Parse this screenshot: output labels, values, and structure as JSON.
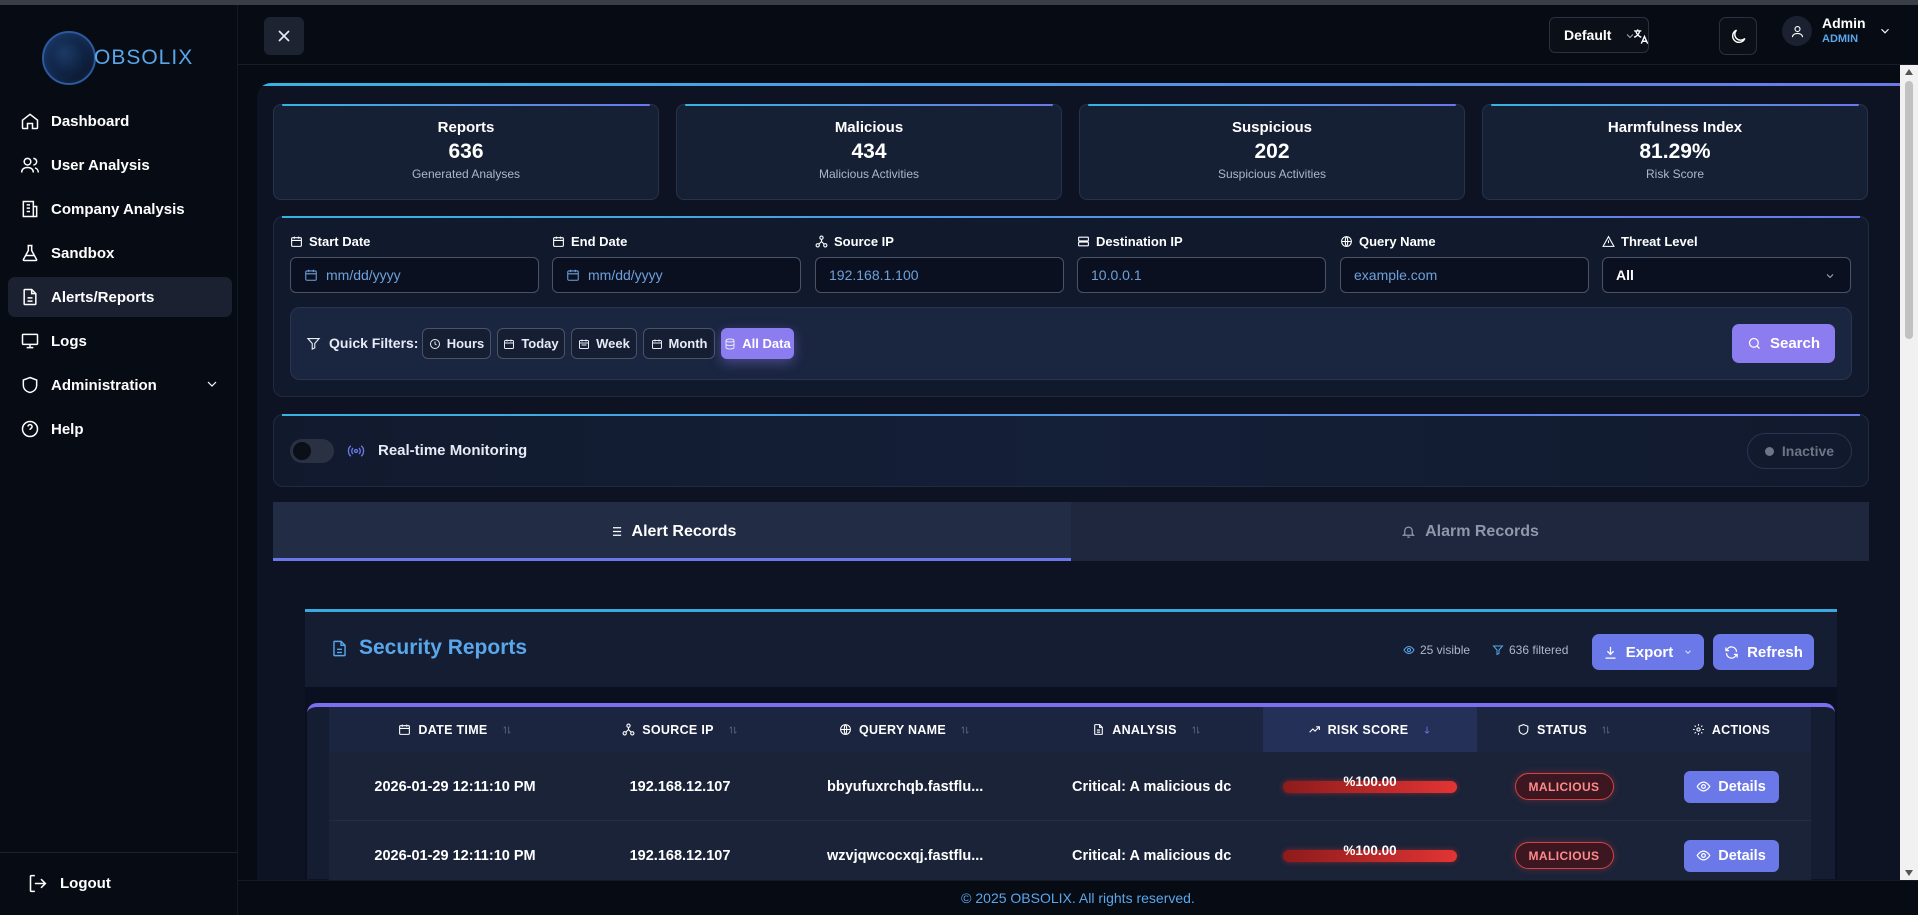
{
  "app": {
    "brand": "OBSOLIX"
  },
  "sidebar": {
    "items": [
      {
        "label": "Dashboard",
        "icon": "home-icon"
      },
      {
        "label": "User Analysis",
        "icon": "users-icon"
      },
      {
        "label": "Company Analysis",
        "icon": "building-icon"
      },
      {
        "label": "Sandbox",
        "icon": "flask-icon"
      },
      {
        "label": "Alerts/Reports",
        "icon": "file-text-icon",
        "active": true
      },
      {
        "label": "Logs",
        "icon": "monitor-icon"
      },
      {
        "label": "Administration",
        "icon": "shield-icon",
        "expandable": true
      },
      {
        "label": "Help",
        "icon": "help-circle-icon"
      }
    ],
    "logout_label": "Logout"
  },
  "topbar": {
    "theme_select": "Default",
    "user_name": "Admin",
    "user_role": "ADMIN"
  },
  "stats": [
    {
      "title": "Reports",
      "value": "636",
      "sub": "Generated Analyses"
    },
    {
      "title": "Malicious",
      "value": "434",
      "sub": "Malicious Activities"
    },
    {
      "title": "Suspicious",
      "value": "202",
      "sub": "Suspicious Activities"
    },
    {
      "title": "Harmfulness Index",
      "value": "81.29%",
      "sub": "Risk Score"
    }
  ],
  "filters": {
    "start_date": {
      "label": "Start Date",
      "placeholder": "mm/dd/yyyy"
    },
    "end_date": {
      "label": "End Date",
      "placeholder": "mm/dd/yyyy"
    },
    "source_ip": {
      "label": "Source IP",
      "placeholder": "192.168.1.100"
    },
    "destination_ip": {
      "label": "Destination IP",
      "placeholder": "10.0.0.1"
    },
    "query_name": {
      "label": "Query Name",
      "placeholder": "example.com"
    },
    "threat_level": {
      "label": "Threat Level",
      "value": "All"
    },
    "quick_label": "Quick Filters:",
    "quick": [
      "Hours",
      "Today",
      "Week",
      "Month",
      "All Data"
    ],
    "quick_active": "All Data",
    "search_label": "Search"
  },
  "monitor": {
    "label": "Real-time Monitoring",
    "enabled": false,
    "status": "Inactive"
  },
  "tabs": [
    {
      "label": "Alert Records",
      "active": true
    },
    {
      "label": "Alarm Records",
      "active": false
    }
  ],
  "reports": {
    "title": "Security Reports",
    "visible_count": "25 visible",
    "filtered_count": "636 filtered",
    "export_label": "Export",
    "refresh_label": "Refresh",
    "columns": [
      "DATE TIME",
      "SOURCE IP",
      "QUERY NAME",
      "ANALYSIS",
      "RISK SCORE",
      "STATUS",
      "ACTIONS"
    ],
    "rows": [
      {
        "date_time": "2026-01-29 12:11:10 PM",
        "source_ip": "192.168.12.107",
        "query_name": "bbyufuxrchqb.fastflu...",
        "analysis": "Critical: A malicious dc",
        "risk_score": "%100.00",
        "risk": 1.0,
        "status": "MALICIOUS",
        "action": "Details"
      },
      {
        "date_time": "2026-01-29 12:11:10 PM",
        "source_ip": "192.168.12.107",
        "query_name": "wzvjqwcocxqj.fastflu...",
        "analysis": "Critical: A malicious dc",
        "risk_score": "%100.00",
        "risk": 1.0,
        "status": "MALICIOUS",
        "action": "Details"
      }
    ]
  },
  "footer": {
    "text": "© 2025 OBSOLIX. All rights reserved."
  },
  "colors": {
    "accent": "#6b78e8",
    "brand": "#5aa6ea",
    "danger": "#e23434",
    "background": "#070b14"
  }
}
